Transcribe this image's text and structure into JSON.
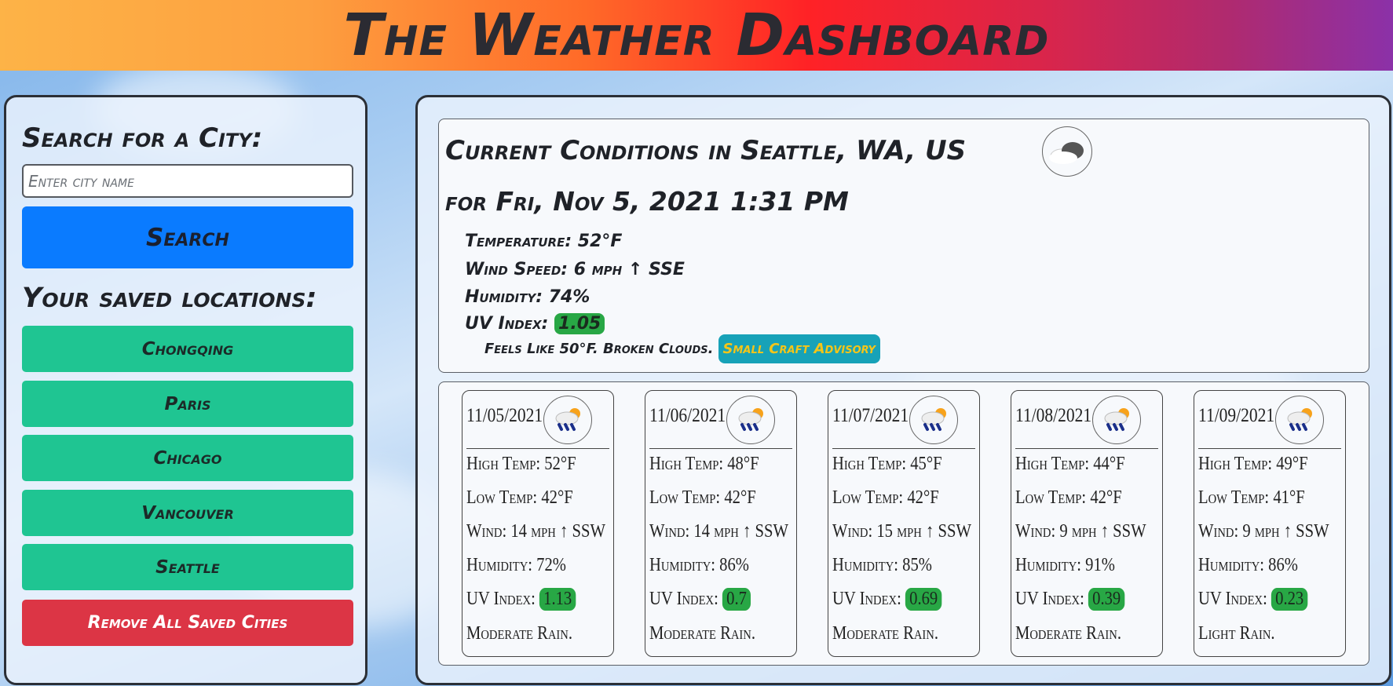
{
  "header": {
    "title": "The Weather Dashboard"
  },
  "search": {
    "title": "Search for a City:",
    "placeholder": "Enter city name",
    "button_label": "Search"
  },
  "saved": {
    "title": "Your saved locations:",
    "cities": [
      "Chongqing",
      "Paris",
      "Chicago",
      "Vancouver",
      "Seattle"
    ],
    "remove_label": "Remove All Saved Cities",
    "city_color": "#1fc592",
    "remove_color": "#dc3545"
  },
  "current": {
    "title": "Current Conditions in Seattle, WA, US",
    "icon": "cloud-icon",
    "date": "for Fri, Nov 5, 2021 1:31 PM",
    "temperature": "Temperature: 52°F",
    "wind": "Wind Speed: 6 mph ↑ SSE",
    "humidity": "Humidity: 74%",
    "uv_label": "UV Index:",
    "uv_value": "1.05",
    "feels": "Feels Like 50°F. Broken Clouds.",
    "advisory": "Small Craft Advisory"
  },
  "forecast": [
    {
      "date": "11/05/2021",
      "icon": "rain-sun-icon",
      "high": "High Temp: 52°F",
      "low": "Low Temp: 42°F",
      "wind": "Wind: 14 mph ↑ SSW",
      "humidity": "Humidity: 72%",
      "uv_label": "UV Index:",
      "uv": "1.13",
      "desc": "Moderate Rain."
    },
    {
      "date": "11/06/2021",
      "icon": "rain-sun-icon",
      "high": "High Temp: 48°F",
      "low": "Low Temp: 42°F",
      "wind": "Wind: 14 mph ↑ SSW",
      "humidity": "Humidity: 86%",
      "uv_label": "UV Index:",
      "uv": "0.7",
      "desc": "Moderate Rain."
    },
    {
      "date": "11/07/2021",
      "icon": "rain-sun-icon",
      "high": "High Temp: 45°F",
      "low": "Low Temp: 42°F",
      "wind": "Wind: 15 mph ↑ SSW",
      "humidity": "Humidity: 85%",
      "uv_label": "UV Index:",
      "uv": "0.69",
      "desc": "Moderate Rain."
    },
    {
      "date": "11/08/2021",
      "icon": "rain-sun-icon",
      "high": "High Temp: 44°F",
      "low": "Low Temp: 42°F",
      "wind": "Wind: 9 mph ↑ SSW",
      "humidity": "Humidity: 91%",
      "uv_label": "UV Index:",
      "uv": "0.39",
      "desc": "Moderate Rain."
    },
    {
      "date": "11/09/2021",
      "icon": "rain-sun-icon",
      "high": "High Temp: 49°F",
      "low": "Low Temp: 41°F",
      "wind": "Wind: 9 mph ↑ SSW",
      "humidity": "Humidity: 86%",
      "uv_label": "UV Index:",
      "uv": "0.23",
      "desc": "Light Rain."
    }
  ]
}
